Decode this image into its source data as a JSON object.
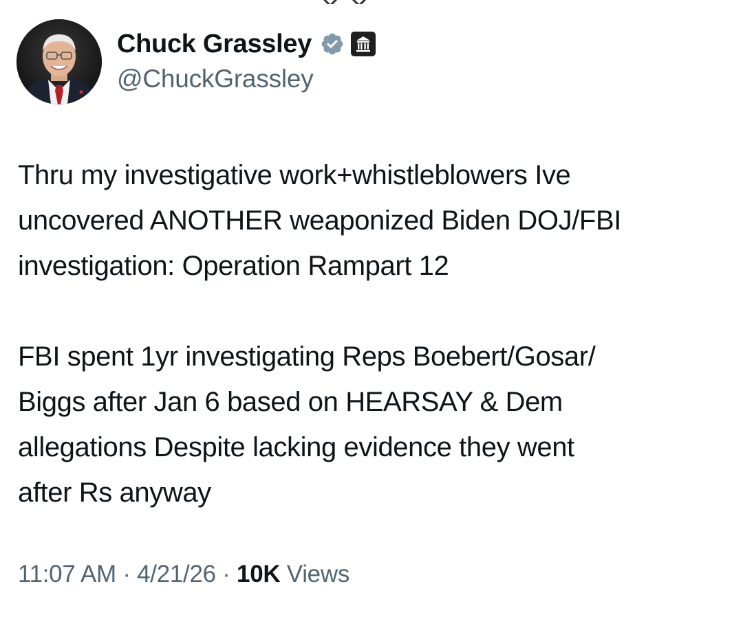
{
  "user": {
    "display_name": "Chuck Grassley",
    "handle": "@ChuckGrassley",
    "verified_icon": "verified-badge",
    "affiliation_icon": "government-building-badge",
    "verified_color": "#829aab",
    "affiliation_color": "#1f1f1f"
  },
  "tweet": {
    "paragraphs": [
      "Thru my investigative work+whistleblowers Ive\nuncovered ANOTHER weaponized Biden DOJ/FBI\ninvestigation: Operation Rampart 12",
      "FBI spent 1yr investigating Reps Boebert/Gosar/\nBiggs after Jan 6 based on HEARSAY & Dem\nallegations Despite lacking evidence they went\nafter Rs anyway"
    ]
  },
  "meta": {
    "time": "11:07 AM",
    "separator": "·",
    "date": "4/21/26",
    "views_count": "10K",
    "views_label": "Views"
  },
  "colors": {
    "text": "#0f1419",
    "secondary": "#536471",
    "background": "#ffffff"
  }
}
